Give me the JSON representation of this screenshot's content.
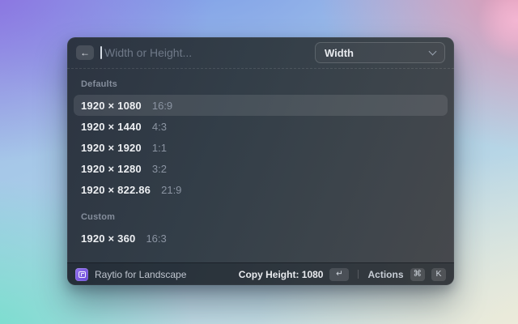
{
  "window": {
    "search": {
      "placeholder": "Width or Height..."
    },
    "dropdown": {
      "selected": "Width"
    }
  },
  "icons": {
    "back": "←",
    "return_key": "↵",
    "command_key": "⌘"
  },
  "sections": [
    {
      "label": "Defaults",
      "items": [
        {
          "size": "1920 × 1080",
          "ratio": "16:9",
          "selected": true
        },
        {
          "size": "1920 × 1440",
          "ratio": "4:3",
          "selected": false
        },
        {
          "size": "1920 × 1920",
          "ratio": "1:1",
          "selected": false
        },
        {
          "size": "1920 × 1280",
          "ratio": "3:2",
          "selected": false
        },
        {
          "size": "1920 × 822.86",
          "ratio": "21:9",
          "selected": false
        }
      ]
    },
    {
      "label": "Custom",
      "items": [
        {
          "size": "1920 × 360",
          "ratio": "16:3",
          "selected": false
        }
      ]
    }
  ],
  "footer": {
    "app_name": "Raytio for Landscape",
    "primary_action": "Copy Height: 1080",
    "actions_label": "Actions",
    "actions_keys": [
      "⌘",
      "K"
    ]
  },
  "colors": {
    "accent_purple": "#7a57dd",
    "window_bg": "#333e48",
    "selected_row": "rgba(255,255,255,0.10)",
    "text_primary": "#edeff2",
    "text_secondary": "#8b94a2"
  }
}
